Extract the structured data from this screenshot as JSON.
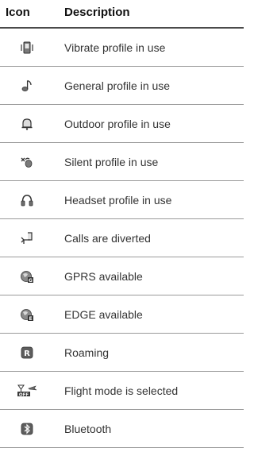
{
  "header": {
    "icon_col": "Icon",
    "desc_col": "Description"
  },
  "rows": [
    {
      "icon": "vibrate-profile-icon",
      "text": "Vibrate profile in use"
    },
    {
      "icon": "general-profile-icon",
      "text": "General profile in use"
    },
    {
      "icon": "outdoor-profile-icon",
      "text": "Outdoor profile in use"
    },
    {
      "icon": "silent-profile-icon",
      "text": "Silent profile in use"
    },
    {
      "icon": "headset-profile-icon",
      "text": "Headset profile in use"
    },
    {
      "icon": "call-divert-icon",
      "text": "Calls are diverted"
    },
    {
      "icon": "gprs-icon",
      "text": "GPRS available"
    },
    {
      "icon": "edge-icon",
      "text": "EDGE available"
    },
    {
      "icon": "roaming-icon",
      "text": "Roaming"
    },
    {
      "icon": "flight-mode-icon",
      "text": "Flight mode is selected"
    },
    {
      "icon": "bluetooth-icon",
      "text": "Bluetooth"
    }
  ]
}
